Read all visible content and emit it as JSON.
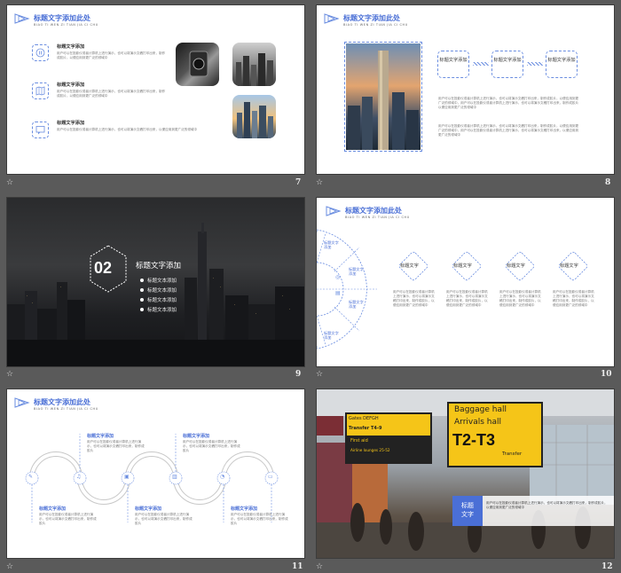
{
  "common": {
    "title": "标题文字添加此处",
    "pinyin": "BIAO TI WEN ZI TIAN JIA CI CHU",
    "star": "☆",
    "label": "标题文字添加"
  },
  "s7": {
    "num": "7",
    "body": "用户可以在投影仪或者计算机上进行演示，也可以将演示文稿打印出来，制作成胶片，以便应用到更广泛的领域中",
    "body2": "用户可以在投影仪或者计算机上进行演示，也可以将演示文稿打印出来，以便应用到更广泛的领域中"
  },
  "s8": {
    "num": "8",
    "card": "标题文字添加",
    "p1": "用户可以在投影仪或者计算机上进行演示，也可以将演示文稿打印出来，制作成胶片，以便应用到更广泛的领域中，用户可以在投影仪或者计算机上进行演示，也可以将演示文稿打印出来，制作成胶片以便应用到更广泛的领域中",
    "p2": "用户可以在投影仪或者计算机上进行演示，也可以将演示文稿打印出来，制作成胶片，以便应用到更广泛的领域中，用户可以在投影仪或者计算机上进行演示，也可以将演示文稿打印出来，以便应用到更广泛的领域中"
  },
  "s9": {
    "num": "9",
    "big": "02",
    "title": "标题文字添加",
    "items": [
      "标题文本添加",
      "标题文本添加",
      "标题文本添加",
      "标题文本添加"
    ]
  },
  "s10": {
    "num": "10",
    "arc_label": "标题文字添加",
    "card": "标题文字",
    "body": "用户可以在投影仪或者计算机上进行演示，也可以将演示文稿打印出来，制作成胶片，以便应用到更广泛的领域中"
  },
  "s11": {
    "num": "11",
    "item": "标题文字添加",
    "body": "用户可以在投影仪或者计算机上进行演示，也可以将演示文稿打印出来，制作成胶片"
  },
  "s12": {
    "num": "12",
    "badge_line1": "标题",
    "badge_line2": "文字",
    "body": "用户可以在投影仪或者计算机上进行演示，也可以将演示文稿打印出来，制作成胶片，以便应用到更广泛的领域中",
    "sign_gates": "Gates DEFGH",
    "sign_transfer": "Transfer T4-9",
    "sign_firstaid": "First aid",
    "sign_lounges": "Airline lounges 25-52",
    "sign_baggage": "Baggage hall",
    "sign_arrivals": "Arrivals hall",
    "sign_t2t3": "T2-T3",
    "sign_transfer2": "Transfer"
  }
}
